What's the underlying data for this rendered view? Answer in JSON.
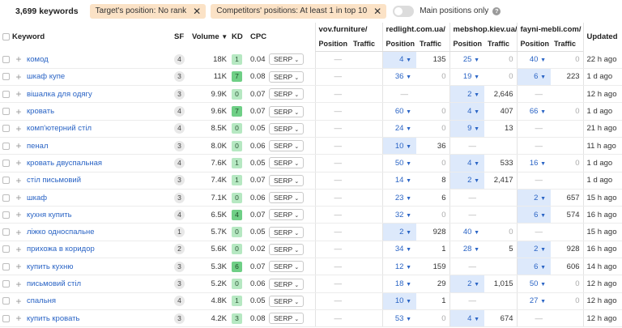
{
  "header": {
    "keyword_count": "3,699 keywords",
    "filters": [
      {
        "label": "Target's position: No rank"
      },
      {
        "label": "Competitors' positions: At least 1 in top 10"
      }
    ],
    "toggle_label": "Main positions only",
    "toggle_on": false
  },
  "columns": {
    "keyword": "Keyword",
    "sf": "SF",
    "volume": "Volume",
    "kd": "KD",
    "cpc": "CPC",
    "competitors": [
      "vov.furniture/",
      "redlight.com.ua/",
      "mebshop.kiev.ua/",
      "fayni-mebli.com/"
    ],
    "position": "Position",
    "traffic": "Traffic",
    "updated": "Updated"
  },
  "serp_label": "SERP",
  "rows": [
    {
      "keyword": "комод",
      "sf": "4",
      "volume": "18K",
      "kd": "1",
      "cpc": "0.04",
      "c1p": "—",
      "c1t": "",
      "c2p": "4",
      "c2t": "135",
      "c3p": "25",
      "c3t": "0",
      "c4p": "40",
      "c4t": "0",
      "updated": "22 h ago",
      "hl": [
        2
      ]
    },
    {
      "keyword": "шкаф купе",
      "sf": "3",
      "volume": "11K",
      "kd": "7",
      "cpc": "0.08",
      "c1p": "—",
      "c1t": "",
      "c2p": "36",
      "c2t": "0",
      "c3p": "19",
      "c3t": "0",
      "c4p": "6",
      "c4t": "223",
      "updated": "1 d ago",
      "hl": [
        4
      ]
    },
    {
      "keyword": "вішалка для одягу",
      "sf": "3",
      "volume": "9.9K",
      "kd": "0",
      "cpc": "0.07",
      "c1p": "—",
      "c1t": "",
      "c2p": "—",
      "c2t": "",
      "c3p": "2",
      "c3t": "2,646",
      "c4p": "—",
      "c4t": "",
      "updated": "12 h ago",
      "hl": [
        3
      ]
    },
    {
      "keyword": "кровать",
      "sf": "4",
      "volume": "9.6K",
      "kd": "7",
      "cpc": "0.07",
      "c1p": "—",
      "c1t": "",
      "c2p": "60",
      "c2t": "0",
      "c3p": "4",
      "c3t": "407",
      "c4p": "66",
      "c4t": "0",
      "updated": "1 d ago",
      "hl": [
        3
      ]
    },
    {
      "keyword": "комп'ютерний стіл",
      "sf": "4",
      "volume": "8.5K",
      "kd": "0",
      "cpc": "0.05",
      "c1p": "—",
      "c1t": "",
      "c2p": "24",
      "c2t": "0",
      "c3p": "9",
      "c3t": "13",
      "c4p": "—",
      "c4t": "",
      "updated": "21 h ago",
      "hl": [
        3
      ]
    },
    {
      "keyword": "пенал",
      "sf": "3",
      "volume": "8.0K",
      "kd": "0",
      "cpc": "0.06",
      "c1p": "—",
      "c1t": "",
      "c2p": "10",
      "c2t": "36",
      "c3p": "—",
      "c3t": "",
      "c4p": "—",
      "c4t": "",
      "updated": "11 h ago",
      "hl": [
        2
      ]
    },
    {
      "keyword": "кровать двуспальная",
      "sf": "4",
      "volume": "7.6K",
      "kd": "1",
      "cpc": "0.05",
      "c1p": "—",
      "c1t": "",
      "c2p": "50",
      "c2t": "0",
      "c3p": "4",
      "c3t": "533",
      "c4p": "16",
      "c4t": "0",
      "updated": "1 d ago",
      "hl": [
        3
      ]
    },
    {
      "keyword": "стіл письмовий",
      "sf": "3",
      "volume": "7.4K",
      "kd": "1",
      "cpc": "0.07",
      "c1p": "—",
      "c1t": "",
      "c2p": "14",
      "c2t": "8",
      "c3p": "2",
      "c3t": "2,417",
      "c4p": "—",
      "c4t": "",
      "updated": "1 d ago",
      "hl": [
        3
      ]
    },
    {
      "keyword": "шкаф",
      "sf": "3",
      "volume": "7.1K",
      "kd": "0",
      "cpc": "0.06",
      "c1p": "—",
      "c1t": "",
      "c2p": "23",
      "c2t": "6",
      "c3p": "—",
      "c3t": "",
      "c4p": "2",
      "c4t": "657",
      "updated": "15 h ago",
      "hl": [
        4
      ]
    },
    {
      "keyword": "кухня купить",
      "sf": "4",
      "volume": "6.5K",
      "kd": "4",
      "cpc": "0.07",
      "c1p": "—",
      "c1t": "",
      "c2p": "32",
      "c2t": "0",
      "c3p": "—",
      "c3t": "",
      "c4p": "6",
      "c4t": "574",
      "updated": "16 h ago",
      "hl": [
        4
      ]
    },
    {
      "keyword": "ліжко односпальне",
      "sf": "1",
      "volume": "5.7K",
      "kd": "0",
      "cpc": "0.05",
      "c1p": "—",
      "c1t": "",
      "c2p": "2",
      "c2t": "928",
      "c3p": "40",
      "c3t": "0",
      "c4p": "—",
      "c4t": "",
      "updated": "15 h ago",
      "hl": [
        2
      ]
    },
    {
      "keyword": "прихожа в коридор",
      "sf": "2",
      "volume": "5.6K",
      "kd": "0",
      "cpc": "0.02",
      "c1p": "—",
      "c1t": "",
      "c2p": "34",
      "c2t": "1",
      "c3p": "28",
      "c3t": "5",
      "c4p": "2",
      "c4t": "928",
      "updated": "16 h ago",
      "hl": [
        4
      ]
    },
    {
      "keyword": "купить кухню",
      "sf": "3",
      "volume": "5.3K",
      "kd": "6",
      "cpc": "0.07",
      "c1p": "—",
      "c1t": "",
      "c2p": "12",
      "c2t": "159",
      "c3p": "—",
      "c3t": "",
      "c4p": "6",
      "c4t": "606",
      "updated": "14 h ago",
      "hl": [
        4
      ]
    },
    {
      "keyword": "письмовий стіл",
      "sf": "3",
      "volume": "5.2K",
      "kd": "0",
      "cpc": "0.06",
      "c1p": "—",
      "c1t": "",
      "c2p": "18",
      "c2t": "29",
      "c3p": "2",
      "c3t": "1,015",
      "c4p": "50",
      "c4t": "0",
      "updated": "12 h ago",
      "hl": [
        3
      ]
    },
    {
      "keyword": "спальня",
      "sf": "4",
      "volume": "4.8K",
      "kd": "1",
      "cpc": "0.05",
      "c1p": "—",
      "c1t": "",
      "c2p": "10",
      "c2t": "1",
      "c3p": "—",
      "c3t": "",
      "c4p": "27",
      "c4t": "0",
      "updated": "12 h ago",
      "hl": [
        2
      ]
    },
    {
      "keyword": "купить кровать",
      "sf": "3",
      "volume": "4.2K",
      "kd": "3",
      "cpc": "0.08",
      "c1p": "—",
      "c1t": "",
      "c2p": "53",
      "c2t": "0",
      "c3p": "4",
      "c3t": "674",
      "c4p": "—",
      "c4t": "",
      "updated": "12 h ago",
      "hl": [
        3
      ]
    }
  ]
}
